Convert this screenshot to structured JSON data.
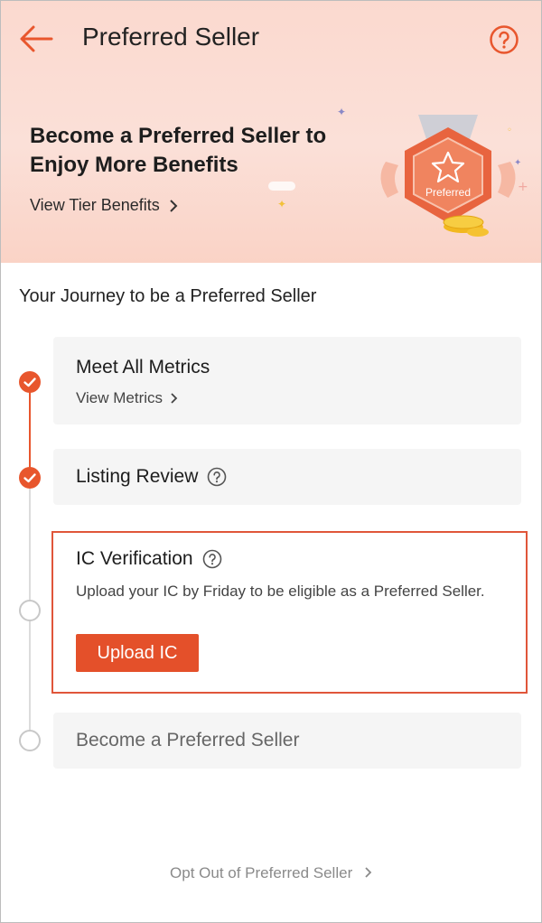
{
  "header": {
    "title": "Preferred Seller",
    "back_icon": "arrow-left-icon",
    "help_icon": "question-circle-icon",
    "accent_color": "#e8562d"
  },
  "hero": {
    "headline": "Become a Preferred Seller to Enjoy More Benefits",
    "tier_link": "View Tier Benefits",
    "badge_label": "Preferred",
    "badge_icon": "star-badge-icon"
  },
  "journey": {
    "title": "Your Journey to be a Preferred Seller",
    "steps": [
      {
        "title": "Meet All Metrics",
        "link": "View Metrics",
        "status": "done"
      },
      {
        "title": "Listing Review",
        "status": "done"
      },
      {
        "title": "IC Verification",
        "description": "Upload your IC by Friday to be eligible as a Preferred Seller.",
        "button": "Upload IC",
        "status": "current"
      },
      {
        "title": "Become a Preferred Seller",
        "status": "pending"
      }
    ]
  },
  "footer": {
    "optout": "Opt Out of Preferred Seller"
  }
}
